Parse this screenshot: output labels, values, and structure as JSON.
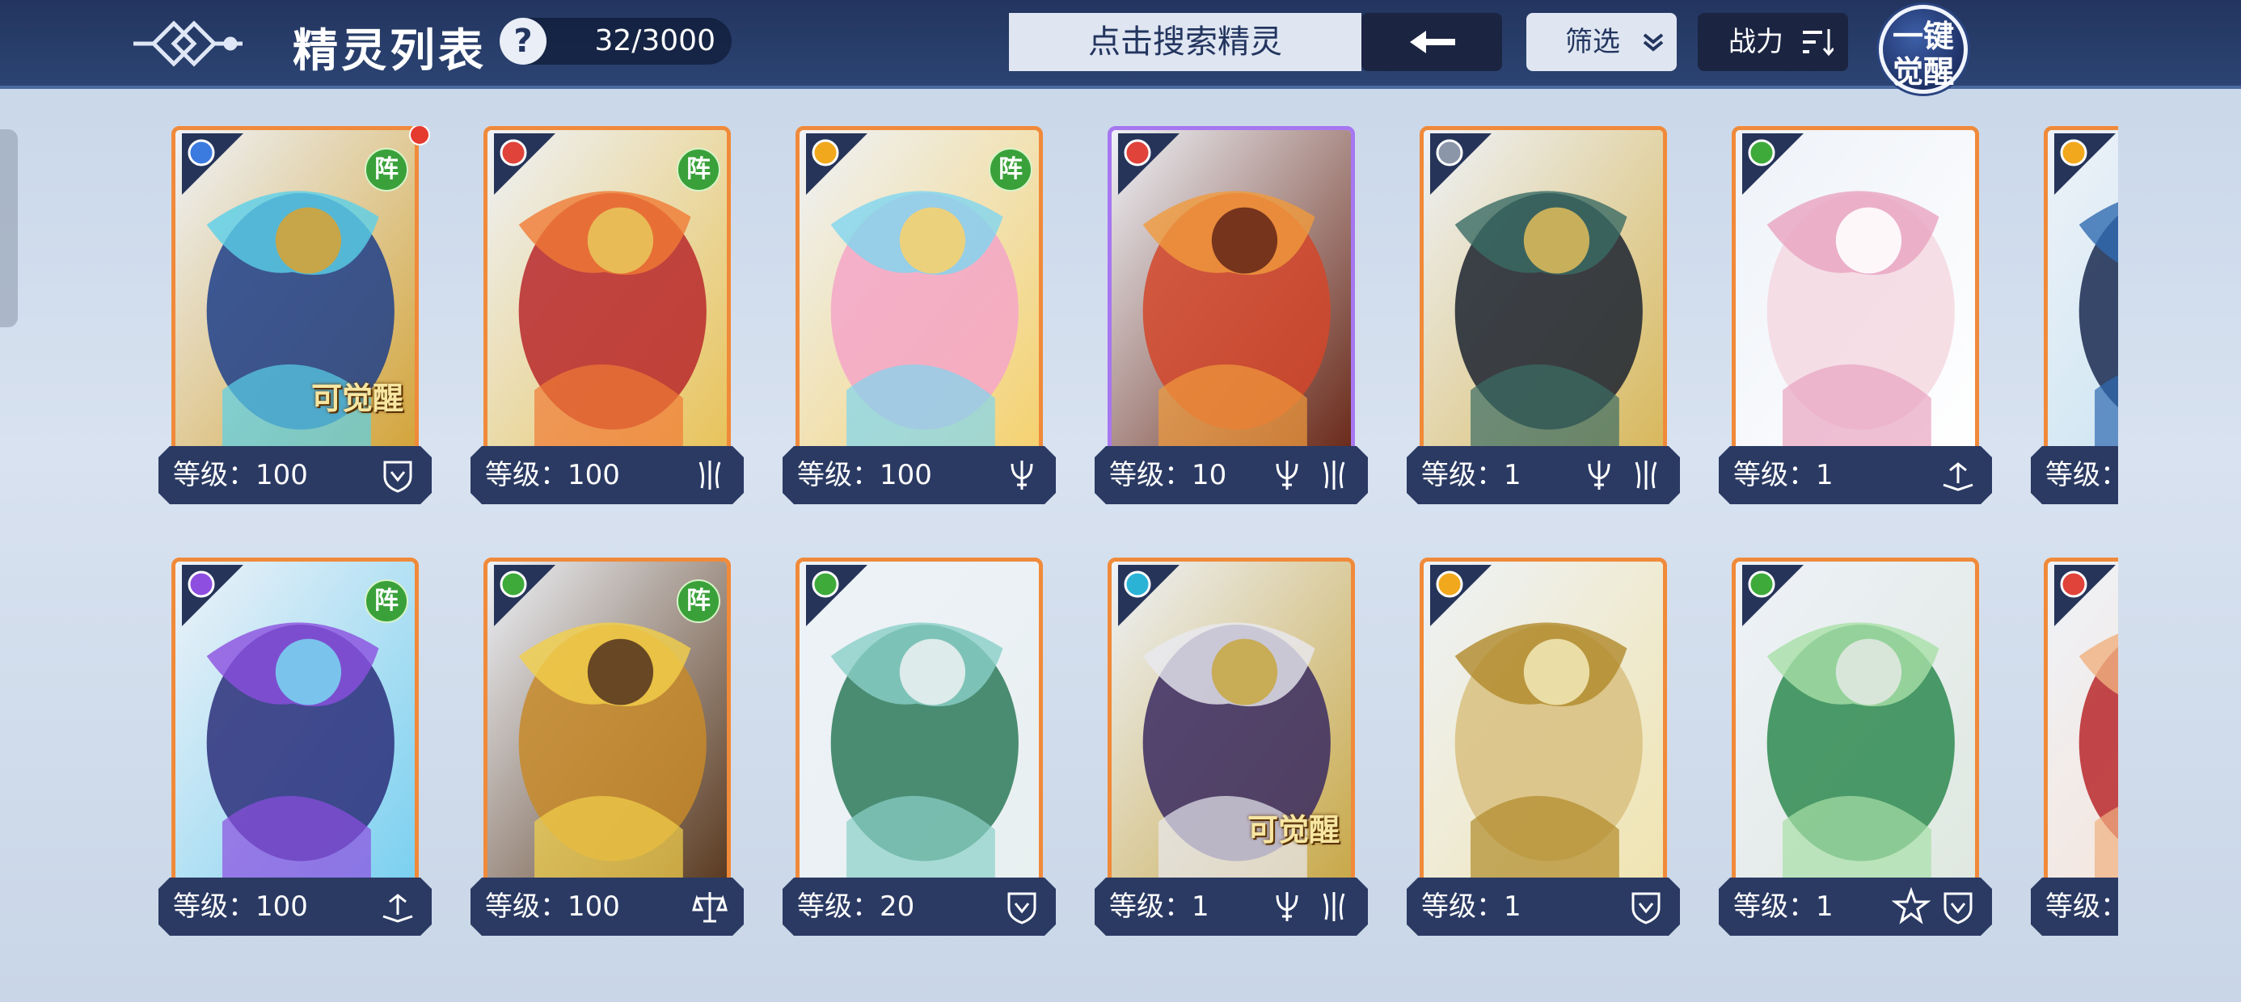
{
  "header": {
    "title": "精灵列表",
    "help_label": "?",
    "count": "32/3000",
    "search_placeholder": "点击搜索精灵",
    "filter_label": "筛选",
    "sort_label": "战力",
    "awaken_line1": "一键",
    "awaken_line2": "觉醒"
  },
  "colors": {
    "header_bg": "#23355f",
    "card_border_orange": "#f08a3a",
    "card_border_purple": "#a677f0",
    "formation_badge": "#3aa13a",
    "level_bar": "#2b3a63"
  },
  "row1": [
    {
      "element": "water-element-icon",
      "formation": "阵",
      "awaken": "可觉醒",
      "level": "等级：100",
      "badges": [
        "shield-badge-icon"
      ]
    },
    {
      "element": "fire-element-icon",
      "formation": "阵",
      "awaken": "",
      "level": "等级：100",
      "badges": [
        "claw-badge-icon"
      ]
    },
    {
      "element": "light-element-icon",
      "formation": "阵",
      "awaken": "",
      "level": "等级：100",
      "badges": [
        "trident-badge-icon"
      ]
    },
    {
      "element": "fire-element-icon",
      "formation": "",
      "awaken": "",
      "level": "等级：10",
      "badges": [
        "trident-badge-icon",
        "claw-badge-icon"
      ]
    },
    {
      "element": "wind-element-icon",
      "formation": "",
      "awaken": "",
      "level": "等级：1",
      "badges": [
        "trident-badge-icon",
        "claw-badge-icon"
      ]
    },
    {
      "element": "grass-element-icon",
      "formation": "",
      "awaken": "",
      "level": "等级：1",
      "badges": [
        "book-badge-icon"
      ]
    },
    {
      "element": "light-element-icon",
      "formation": "",
      "awaken": "",
      "level": "等级：",
      "badges": []
    }
  ],
  "row2": [
    {
      "element": "dark-element-icon",
      "formation": "阵",
      "awaken": "",
      "level": "等级：100",
      "badges": [
        "book-badge-icon"
      ]
    },
    {
      "element": "grass-element-icon",
      "formation": "阵",
      "awaken": "",
      "level": "等级：100",
      "badges": [
        "scale-badge-icon"
      ]
    },
    {
      "element": "grass-element-icon",
      "formation": "",
      "awaken": "",
      "level": "等级：20",
      "badges": [
        "shield-badge-icon"
      ]
    },
    {
      "element": "ice-element-icon",
      "formation": "",
      "awaken": "可觉醒",
      "level": "等级：1",
      "badges": [
        "trident-badge-icon",
        "claw-badge-icon"
      ]
    },
    {
      "element": "light-element-icon",
      "formation": "",
      "awaken": "",
      "level": "等级：1",
      "badges": [
        "shield-badge-icon"
      ]
    },
    {
      "element": "grass-element-icon",
      "formation": "",
      "awaken": "",
      "level": "等级：1",
      "badges": [
        "star-badge-icon",
        "shield-badge-icon"
      ]
    },
    {
      "element": "fire-element-icon",
      "formation": "",
      "awaken": "",
      "level": "等级：",
      "badges": []
    }
  ]
}
